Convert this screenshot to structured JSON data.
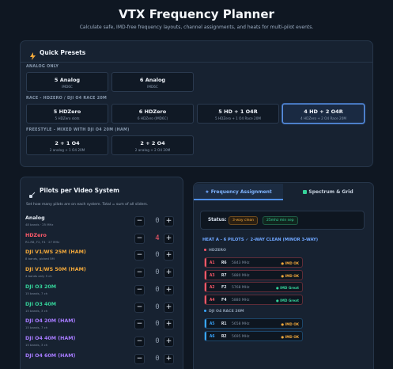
{
  "header": {
    "title": "VTX Frequency Planner",
    "subtitle": "Calculate safe, IMD-free frequency layouts, channel assignments, and heats for multi-pilot events."
  },
  "presets": {
    "title": "Quick Presets",
    "icon": "bolt-icon",
    "sections": [
      {
        "label": "ANALOG ONLY",
        "items": [
          {
            "title": "5 Analog",
            "sub": "IMD6C"
          },
          {
            "title": "6 Analog",
            "sub": "IMD6C"
          }
        ]
      },
      {
        "label": "RACE - HDZERO / DJI O4 RACE 20M",
        "items": [
          {
            "title": "5 HDZero",
            "sub": "5 HDZero slots"
          },
          {
            "title": "6 HDZero",
            "sub": "6 HDZero (IMD6C)"
          },
          {
            "title": "5 HD + 1 O4R",
            "sub": "5 HDZero + 1 O4 Race 20M"
          },
          {
            "title": "4 HD + 2 O4R",
            "sub": "4 HDZero + 2 O4 Race 20M"
          }
        ]
      },
      {
        "label": "FREESTYLE - MIXED WITH DJI O4 20M (HAM)",
        "items": [
          {
            "title": "2 + 1 O4",
            "sub": "2 analog + 1 O4 20M"
          },
          {
            "title": "2 + 2 O4",
            "sub": "2 analog + 2 O4 20M"
          }
        ]
      }
    ],
    "active_index": 3
  },
  "pilots": {
    "title": "Pilots per Video System",
    "description": "Set how many pilots are on each system. Total = sum of all sliders.",
    "systems": [
      {
        "name": "Analog",
        "sub": "48 bands · 25 MHz",
        "value": "0",
        "color": "#e7edf5"
      },
      {
        "name": "HDZero",
        "sub": "R1-R8, F2, F4 · 27 MHz",
        "value": "4",
        "color": "#ff5a6a"
      },
      {
        "name": "DJI V1/WS 25M (HAM)",
        "sub": "8 bands, picked 5M",
        "value": "0",
        "color": "#f3a93b"
      },
      {
        "name": "DJI V1/WS 50M (HAM)",
        "sub": "4 bands only 5 ch",
        "value": "0",
        "color": "#f3a93b"
      },
      {
        "name": "DJI O3 20M",
        "sub": "15 bands, 7 ch",
        "value": "0",
        "color": "#35d39a"
      },
      {
        "name": "DJI O3 40M",
        "sub": "15 bands, 3 ch",
        "value": "0",
        "color": "#35d39a"
      },
      {
        "name": "DJI O4 20M (HAM)",
        "sub": "15 bands, 7 ch",
        "value": "0",
        "color": "#a77bff"
      },
      {
        "name": "DJI O4 40M (HAM)",
        "sub": "15 bands, 3 ch",
        "value": "0",
        "color": "#a77bff"
      },
      {
        "name": "DJI O4 60M (HAM)",
        "sub": "",
        "value": "0",
        "color": "#a77bff"
      }
    ]
  },
  "tabs": [
    {
      "label": "Frequency Assignment",
      "icon": "star-icon"
    },
    {
      "label": "Spectrum & Grid",
      "icon": "grid-icon"
    }
  ],
  "status": {
    "label": "Status:",
    "badges": [
      {
        "text": "3-way clean",
        "color": "#f3a93b"
      },
      {
        "text": "25mhz min sep",
        "color": "#35d39a"
      }
    ]
  },
  "heat": {
    "title": "HEAT A - 6 PILOTS ✓ 2-WAY CLEAN (MINOR 3-WAY)",
    "groups": [
      {
        "label": "HDZERO",
        "color": "#ff5a6a",
        "channels": [
          {
            "code": "A1",
            "band": "R6",
            "freq": "5843 MHz",
            "status": "● IMD OK",
            "status_color": "#f3a93b"
          },
          {
            "code": "A3",
            "band": "R7",
            "freq": "5880 MHz",
            "status": "● IMD OK",
            "status_color": "#f3a93b"
          },
          {
            "code": "A2",
            "band": "F2",
            "freq": "5768 MHz",
            "status": "● IMD Great",
            "status_color": "#35d39a"
          },
          {
            "code": "A4",
            "band": "F4",
            "freq": "5880 MHz",
            "status": "● IMD Great",
            "status_color": "#35d39a"
          }
        ]
      },
      {
        "label": "DJI O4 RACE 20M",
        "color": "#3aa7ff",
        "channels": [
          {
            "code": "A5",
            "band": "R1",
            "freq": "5658 MHz",
            "status": "● IMD OK",
            "status_color": "#f3a93b"
          },
          {
            "code": "A6",
            "band": "R2",
            "freq": "5695 MHz",
            "status": "● IMD OK",
            "status_color": "#f3a93b"
          }
        ]
      }
    ]
  }
}
